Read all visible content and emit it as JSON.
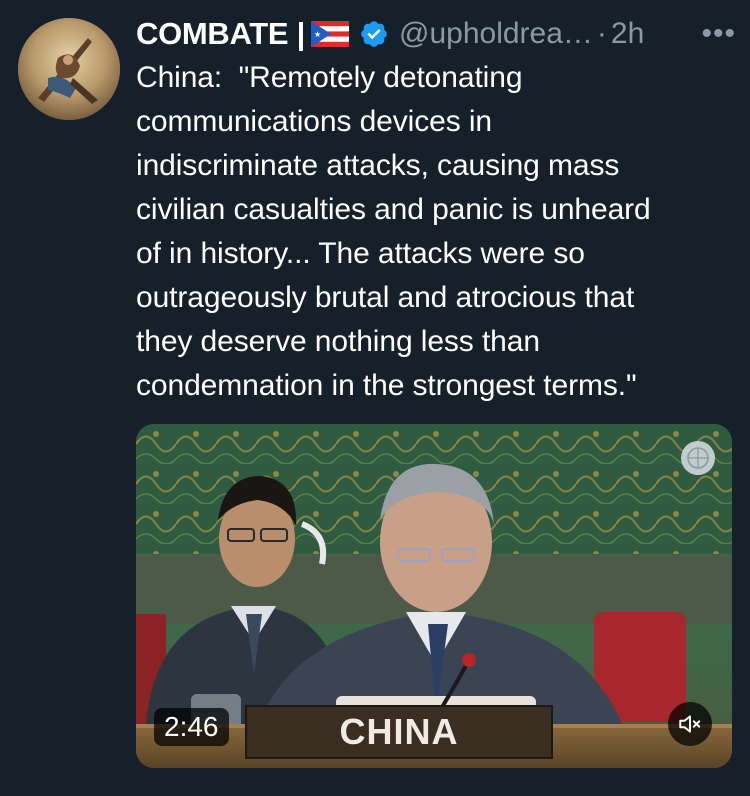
{
  "tweet": {
    "display_name": "COMBATE |",
    "handle": "@upholdrea…",
    "separator": "·",
    "time": "2h",
    "more_label": "•••",
    "text": "China:  \"Remotely detonating\ncommunications devices in\nindiscriminate attacks, causing mass\ncivilian casualties and panic is unheard\nof in history... The attacks were so\noutrageously brutal and atrocious that\nthey deserve nothing less than\ncondemnation in the strongest terms.\""
  },
  "video": {
    "duration": "2:46",
    "nameplate": "CHINA"
  },
  "colors": {
    "background": "#15202b",
    "verified": "#1d9bf0",
    "muted_text": "#8b98a5"
  }
}
